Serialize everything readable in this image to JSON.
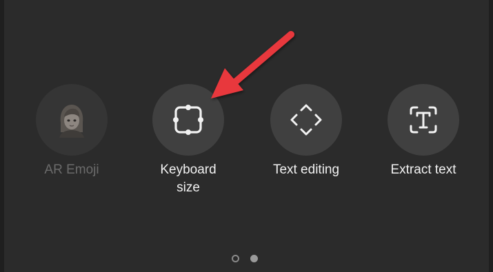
{
  "toolbar": {
    "tiles": [
      {
        "label": "AR Emoji",
        "icon": "ar-emoji-avatar-icon",
        "enabled": false
      },
      {
        "label": "Keyboard\nsize",
        "icon": "keyboard-size-icon",
        "enabled": true
      },
      {
        "label": "Text editing",
        "icon": "text-editing-arrows-icon",
        "enabled": true
      },
      {
        "label": "Extract text",
        "icon": "extract-text-icon",
        "enabled": true
      }
    ]
  },
  "pager": {
    "pages": 2,
    "current": 2
  },
  "annotation": {
    "type": "arrow",
    "color": "#e8383d",
    "points_to": "Keyboard size"
  },
  "colors": {
    "background": "#2b2b2b",
    "tile": "#404040",
    "text": "#f2f2f2",
    "disabled_text": "#6b6b6b"
  }
}
